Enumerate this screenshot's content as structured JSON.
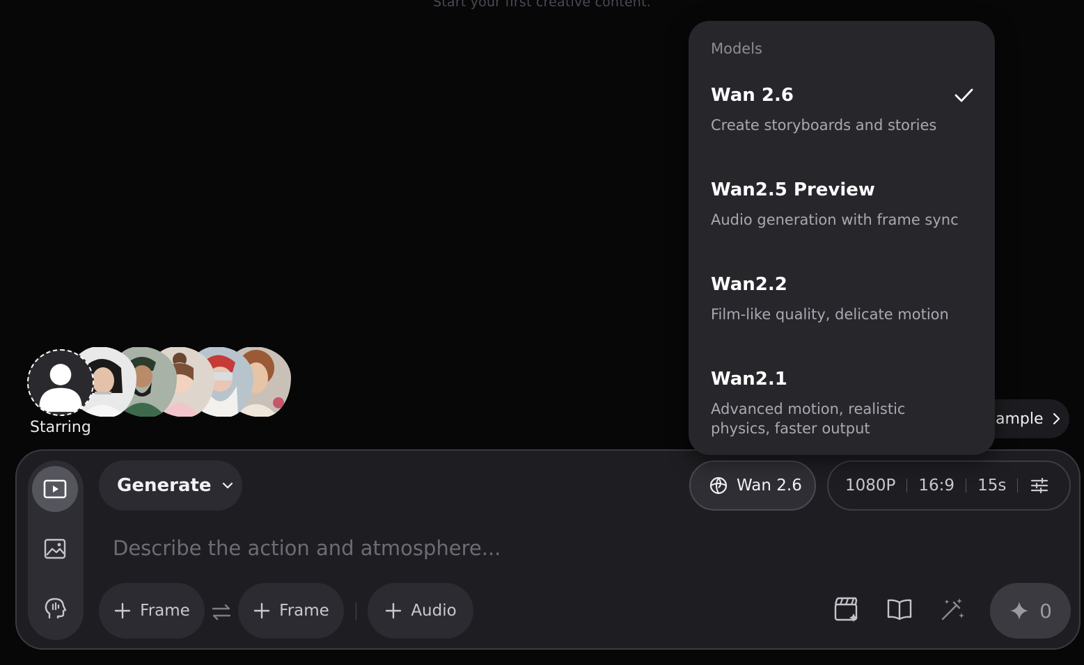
{
  "hint": "Start your first creative content.",
  "starring": {
    "label": "Starring"
  },
  "composer": {
    "generate_label": "Generate",
    "model_label": "Wan 2.6",
    "resolution": "1080P",
    "aspect": "16:9",
    "duration": "15s",
    "prompt_placeholder": "Describe the action and atmosphere...",
    "chips": {
      "frame_start": "Frame",
      "frame_end": "Frame",
      "audio": "Audio"
    },
    "credits": "0"
  },
  "example_label": "ample",
  "models_menu": {
    "title": "Models",
    "items": [
      {
        "name": "Wan 2.6",
        "desc": "Create storyboards and stories",
        "selected": true
      },
      {
        "name": "Wan2.5 Preview",
        "desc": "Audio generation with frame sync",
        "selected": false
      },
      {
        "name": "Wan2.2",
        "desc": "Film-like quality, delicate motion",
        "selected": false
      },
      {
        "name": "Wan2.1",
        "desc": "Advanced motion, realistic physics, faster output",
        "selected": false
      }
    ]
  },
  "colors": {
    "background": "#070708",
    "panel": "#1e1e22",
    "menu": "#26262b",
    "accent_text": "#ffffff"
  }
}
